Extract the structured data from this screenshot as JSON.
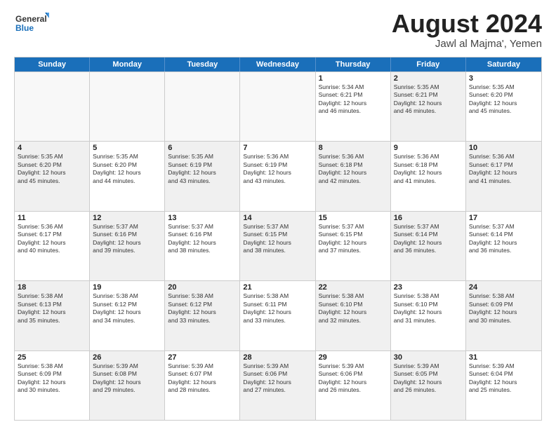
{
  "logo": {
    "line1": "General",
    "line2": "Blue"
  },
  "title": "August 2024",
  "location": "Jawl al Majma', Yemen",
  "days_of_week": [
    "Sunday",
    "Monday",
    "Tuesday",
    "Wednesday",
    "Thursday",
    "Friday",
    "Saturday"
  ],
  "weeks": [
    [
      {
        "day": "",
        "text": "",
        "empty": true
      },
      {
        "day": "",
        "text": "",
        "empty": true
      },
      {
        "day": "",
        "text": "",
        "empty": true
      },
      {
        "day": "",
        "text": "",
        "empty": true
      },
      {
        "day": "1",
        "text": "Sunrise: 5:34 AM\nSunset: 6:21 PM\nDaylight: 12 hours\nand 46 minutes.",
        "shaded": false
      },
      {
        "day": "2",
        "text": "Sunrise: 5:35 AM\nSunset: 6:21 PM\nDaylight: 12 hours\nand 46 minutes.",
        "shaded": true
      },
      {
        "day": "3",
        "text": "Sunrise: 5:35 AM\nSunset: 6:20 PM\nDaylight: 12 hours\nand 45 minutes.",
        "shaded": false
      }
    ],
    [
      {
        "day": "4",
        "text": "Sunrise: 5:35 AM\nSunset: 6:20 PM\nDaylight: 12 hours\nand 45 minutes.",
        "shaded": true
      },
      {
        "day": "5",
        "text": "Sunrise: 5:35 AM\nSunset: 6:20 PM\nDaylight: 12 hours\nand 44 minutes.",
        "shaded": false
      },
      {
        "day": "6",
        "text": "Sunrise: 5:35 AM\nSunset: 6:19 PM\nDaylight: 12 hours\nand 43 minutes.",
        "shaded": true
      },
      {
        "day": "7",
        "text": "Sunrise: 5:36 AM\nSunset: 6:19 PM\nDaylight: 12 hours\nand 43 minutes.",
        "shaded": false
      },
      {
        "day": "8",
        "text": "Sunrise: 5:36 AM\nSunset: 6:18 PM\nDaylight: 12 hours\nand 42 minutes.",
        "shaded": true
      },
      {
        "day": "9",
        "text": "Sunrise: 5:36 AM\nSunset: 6:18 PM\nDaylight: 12 hours\nand 41 minutes.",
        "shaded": false
      },
      {
        "day": "10",
        "text": "Sunrise: 5:36 AM\nSunset: 6:17 PM\nDaylight: 12 hours\nand 41 minutes.",
        "shaded": true
      }
    ],
    [
      {
        "day": "11",
        "text": "Sunrise: 5:36 AM\nSunset: 6:17 PM\nDaylight: 12 hours\nand 40 minutes.",
        "shaded": false
      },
      {
        "day": "12",
        "text": "Sunrise: 5:37 AM\nSunset: 6:16 PM\nDaylight: 12 hours\nand 39 minutes.",
        "shaded": true
      },
      {
        "day": "13",
        "text": "Sunrise: 5:37 AM\nSunset: 6:16 PM\nDaylight: 12 hours\nand 38 minutes.",
        "shaded": false
      },
      {
        "day": "14",
        "text": "Sunrise: 5:37 AM\nSunset: 6:15 PM\nDaylight: 12 hours\nand 38 minutes.",
        "shaded": true
      },
      {
        "day": "15",
        "text": "Sunrise: 5:37 AM\nSunset: 6:15 PM\nDaylight: 12 hours\nand 37 minutes.",
        "shaded": false
      },
      {
        "day": "16",
        "text": "Sunrise: 5:37 AM\nSunset: 6:14 PM\nDaylight: 12 hours\nand 36 minutes.",
        "shaded": true
      },
      {
        "day": "17",
        "text": "Sunrise: 5:37 AM\nSunset: 6:14 PM\nDaylight: 12 hours\nand 36 minutes.",
        "shaded": false
      }
    ],
    [
      {
        "day": "18",
        "text": "Sunrise: 5:38 AM\nSunset: 6:13 PM\nDaylight: 12 hours\nand 35 minutes.",
        "shaded": true
      },
      {
        "day": "19",
        "text": "Sunrise: 5:38 AM\nSunset: 6:12 PM\nDaylight: 12 hours\nand 34 minutes.",
        "shaded": false
      },
      {
        "day": "20",
        "text": "Sunrise: 5:38 AM\nSunset: 6:12 PM\nDaylight: 12 hours\nand 33 minutes.",
        "shaded": true
      },
      {
        "day": "21",
        "text": "Sunrise: 5:38 AM\nSunset: 6:11 PM\nDaylight: 12 hours\nand 33 minutes.",
        "shaded": false
      },
      {
        "day": "22",
        "text": "Sunrise: 5:38 AM\nSunset: 6:10 PM\nDaylight: 12 hours\nand 32 minutes.",
        "shaded": true
      },
      {
        "day": "23",
        "text": "Sunrise: 5:38 AM\nSunset: 6:10 PM\nDaylight: 12 hours\nand 31 minutes.",
        "shaded": false
      },
      {
        "day": "24",
        "text": "Sunrise: 5:38 AM\nSunset: 6:09 PM\nDaylight: 12 hours\nand 30 minutes.",
        "shaded": true
      }
    ],
    [
      {
        "day": "25",
        "text": "Sunrise: 5:38 AM\nSunset: 6:09 PM\nDaylight: 12 hours\nand 30 minutes.",
        "shaded": false
      },
      {
        "day": "26",
        "text": "Sunrise: 5:39 AM\nSunset: 6:08 PM\nDaylight: 12 hours\nand 29 minutes.",
        "shaded": true
      },
      {
        "day": "27",
        "text": "Sunrise: 5:39 AM\nSunset: 6:07 PM\nDaylight: 12 hours\nand 28 minutes.",
        "shaded": false
      },
      {
        "day": "28",
        "text": "Sunrise: 5:39 AM\nSunset: 6:06 PM\nDaylight: 12 hours\nand 27 minutes.",
        "shaded": true
      },
      {
        "day": "29",
        "text": "Sunrise: 5:39 AM\nSunset: 6:06 PM\nDaylight: 12 hours\nand 26 minutes.",
        "shaded": false
      },
      {
        "day": "30",
        "text": "Sunrise: 5:39 AM\nSunset: 6:05 PM\nDaylight: 12 hours\nand 26 minutes.",
        "shaded": true
      },
      {
        "day": "31",
        "text": "Sunrise: 5:39 AM\nSunset: 6:04 PM\nDaylight: 12 hours\nand 25 minutes.",
        "shaded": false
      }
    ]
  ]
}
